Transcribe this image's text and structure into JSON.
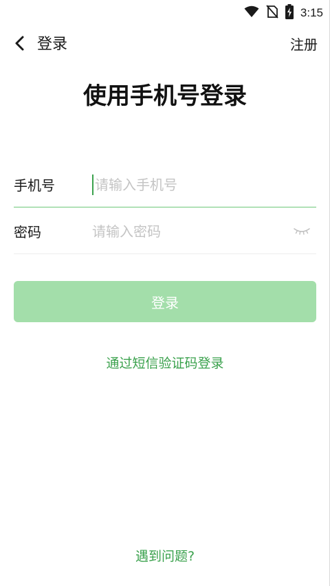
{
  "status_bar": {
    "time": "3:15",
    "icons": [
      "wifi-icon",
      "no-sim-icon",
      "battery-charging-icon"
    ]
  },
  "nav": {
    "back_icon": "chevron-left-icon",
    "title": "登录",
    "register_label": "注册"
  },
  "main": {
    "heading": "使用手机号登录"
  },
  "form": {
    "phone": {
      "label": "手机号",
      "value": "",
      "placeholder": "请输入手机号"
    },
    "password": {
      "label": "密码",
      "value": "",
      "placeholder": "请输入密码",
      "visibility_icon": "eye-closed-icon"
    }
  },
  "actions": {
    "login_label": "登录",
    "sms_login_label": "通过短信验证码登录",
    "help_label": "遇到问题?"
  },
  "colors": {
    "accent": "#3aa14c",
    "button_disabled": "#a3deaa",
    "input_active_underline": "#6cc878"
  }
}
